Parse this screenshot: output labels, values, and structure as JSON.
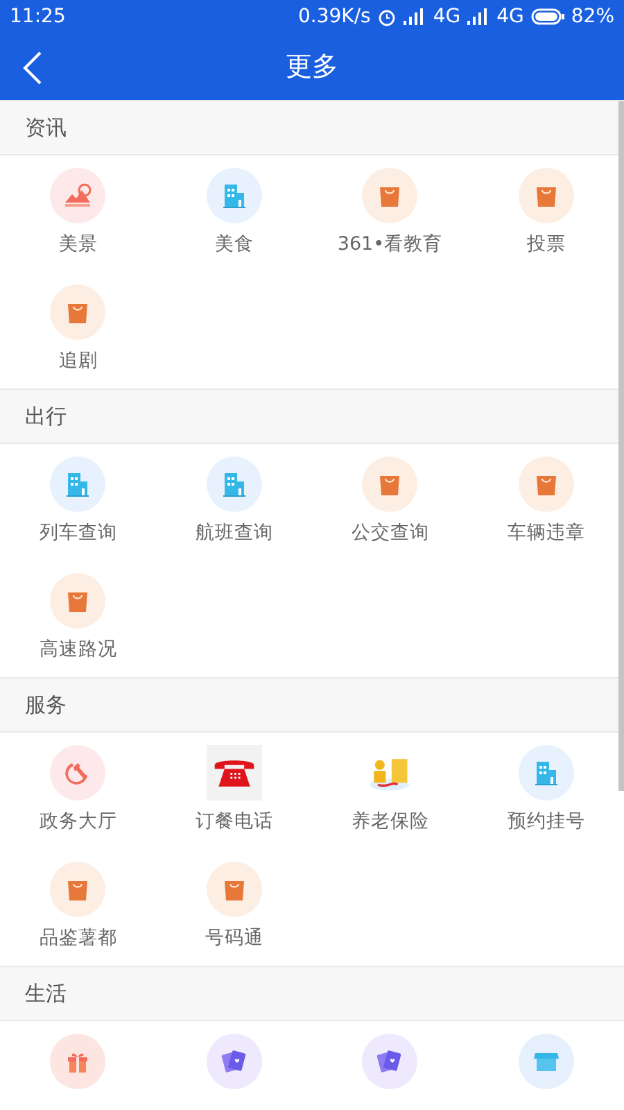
{
  "status_bar": {
    "time": "11:25",
    "speed": "0.39K/s",
    "network_1": "4G",
    "network_2": "4G",
    "battery": "82%"
  },
  "header": {
    "title": "更多"
  },
  "sections": [
    {
      "title": "资讯",
      "items": [
        {
          "kind": "landscape",
          "label": "美景"
        },
        {
          "kind": "building",
          "label": "美食"
        },
        {
          "kind": "bag",
          "label": "361•看教育"
        },
        {
          "kind": "bag",
          "label": "投票"
        },
        {
          "kind": "bag",
          "label": "追剧"
        }
      ]
    },
    {
      "title": "出行",
      "items": [
        {
          "kind": "building",
          "label": "列车查询"
        },
        {
          "kind": "building",
          "label": "航班查询"
        },
        {
          "kind": "bag",
          "label": "公交查询"
        },
        {
          "kind": "bag",
          "label": "车辆违章"
        },
        {
          "kind": "bag",
          "label": "高速路况"
        }
      ]
    },
    {
      "title": "服务",
      "items": [
        {
          "kind": "emblem",
          "label": "政务大厅"
        },
        {
          "kind": "phone",
          "label": "订餐电话"
        },
        {
          "kind": "coins",
          "label": "养老保险"
        },
        {
          "kind": "building",
          "label": "预约挂号"
        },
        {
          "kind": "bag",
          "label": "品鉴薯都"
        },
        {
          "kind": "bag",
          "label": "号码通"
        }
      ]
    },
    {
      "title": "生活",
      "items": [
        {
          "kind": "gift"
        },
        {
          "kind": "cards"
        },
        {
          "kind": "cards"
        },
        {
          "kind": "shop"
        }
      ]
    }
  ]
}
